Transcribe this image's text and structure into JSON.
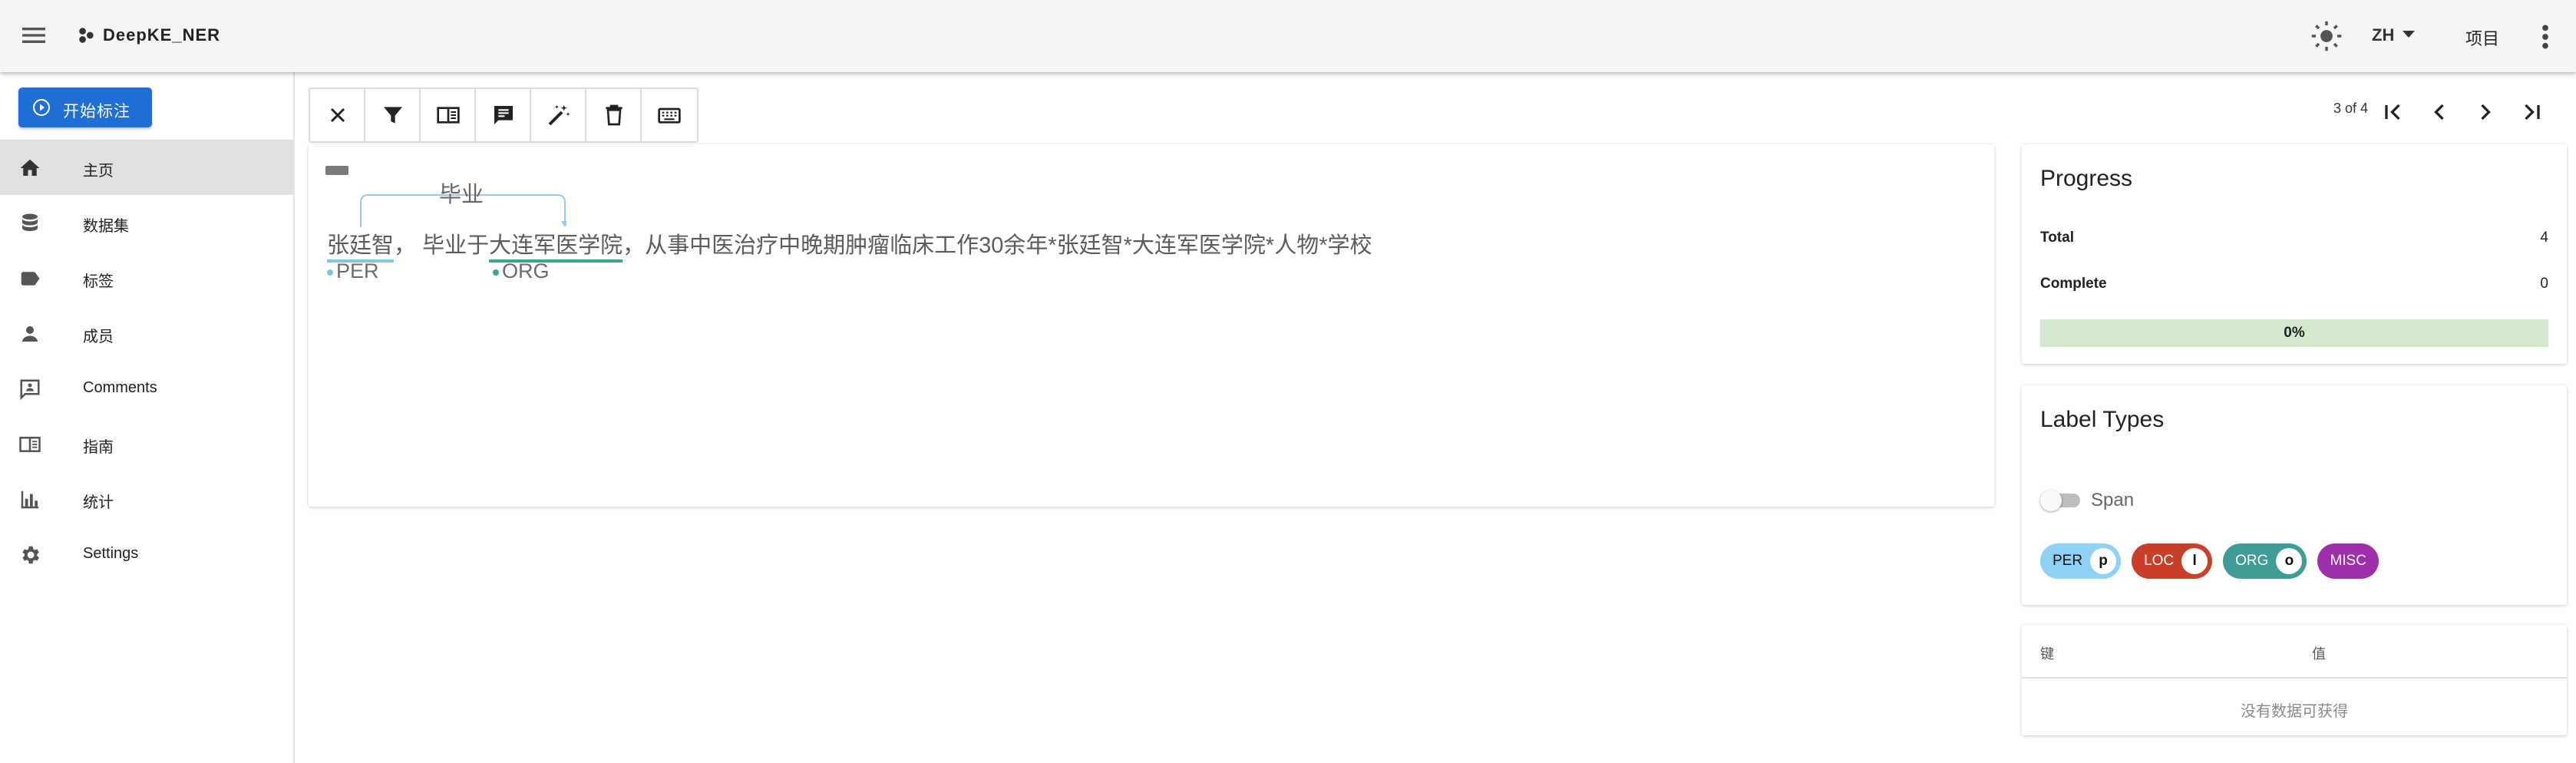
{
  "app": {
    "brand": "DeepKE_NER",
    "lang": "ZH",
    "projects_label": "项目"
  },
  "sidebar": {
    "start_button": "开始标注",
    "items": [
      {
        "label": "主页",
        "icon": "home-icon"
      },
      {
        "label": "数据集",
        "icon": "database-icon"
      },
      {
        "label": "标签",
        "icon": "label-icon"
      },
      {
        "label": "成员",
        "icon": "person-icon"
      },
      {
        "label": "Comments",
        "icon": "comment-icon"
      },
      {
        "label": "指南",
        "icon": "book-icon"
      },
      {
        "label": "统计",
        "icon": "chart-icon"
      },
      {
        "label": "Settings",
        "icon": "gear-icon"
      }
    ],
    "active": "主页"
  },
  "toolbar": {
    "buttons": [
      "close-icon",
      "filter-icon",
      "book-open-icon",
      "comment-icon",
      "auto-label-icon",
      "delete-icon",
      "keyboard-icon"
    ]
  },
  "pager": {
    "text": "3 of 4"
  },
  "annotation": {
    "relation_label": "毕业",
    "segments": {
      "s1": "张廷智",
      "s2": "，  毕业于",
      "s3": "大连军医学院",
      "s4": "，从事中医治疗中晚期肿瘤临床工作30余年*张廷智*大连军医学院*人物*学校"
    },
    "entity_tags": [
      "PER",
      "ORG"
    ]
  },
  "progress": {
    "title": "Progress",
    "total_label": "Total",
    "total": "4",
    "complete_label": "Complete",
    "complete": "0",
    "percent_text": "0%",
    "percent": 0
  },
  "label_types": {
    "title": "Label Types",
    "toggle_label": "Span",
    "labels": [
      {
        "name": "PER",
        "key": "p",
        "bg": "#8fd1f5",
        "fg": "#111111"
      },
      {
        "name": "LOC",
        "key": "l",
        "bg": "#c8402a",
        "fg": "#ffffff"
      },
      {
        "name": "ORG",
        "key": "o",
        "bg": "#3f9c96",
        "fg": "#ffffff"
      },
      {
        "name": "MISC",
        "key": "",
        "bg": "#9d2fa8",
        "fg": "#ffffff"
      }
    ]
  },
  "metadata": {
    "key_header": "键",
    "value_header": "值",
    "empty_text": "没有数据可获得"
  },
  "colors": {
    "primary": "#1f6fd6",
    "per_underline": "#7fc5e8",
    "org_underline": "#3aa58e"
  }
}
